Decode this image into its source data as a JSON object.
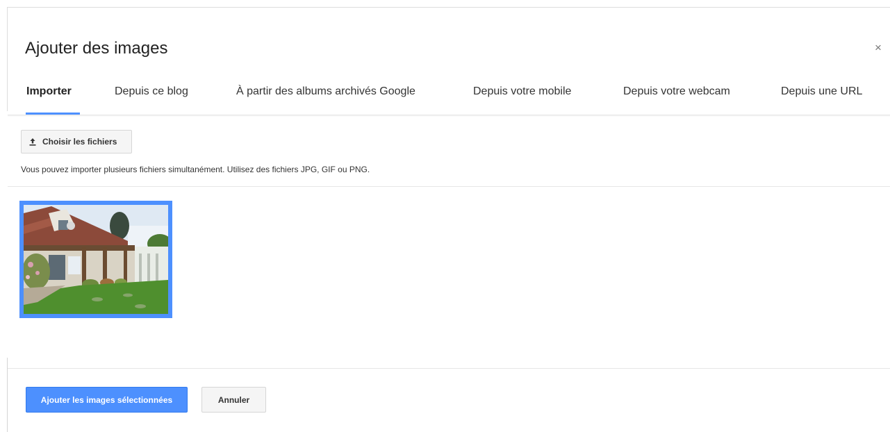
{
  "dialog": {
    "title": "Ajouter des images",
    "close_symbol": "×"
  },
  "tabs": [
    {
      "label": "Importer",
      "active": true
    },
    {
      "label": "Depuis ce blog",
      "active": false
    },
    {
      "label": "À partir des albums archivés Google",
      "active": false
    },
    {
      "label": "Depuis votre mobile",
      "active": false
    },
    {
      "label": "Depuis votre webcam",
      "active": false
    },
    {
      "label": "Depuis une URL",
      "active": false
    }
  ],
  "upload": {
    "choose_label": "Choisir les fichiers",
    "choose_icon": "upload-icon",
    "hint": "Vous pouvez importer plusieurs fichiers simultanément. Utilisez des fichiers JPG, GIF ou PNG."
  },
  "images": [
    {
      "selected": true,
      "subject": "house-photo"
    }
  ],
  "footer": {
    "add_label": "Ajouter les images sélectionnées",
    "cancel_label": "Annuler"
  },
  "colors": {
    "accent": "#4d90fe",
    "button_bg": "#f5f5f5"
  }
}
